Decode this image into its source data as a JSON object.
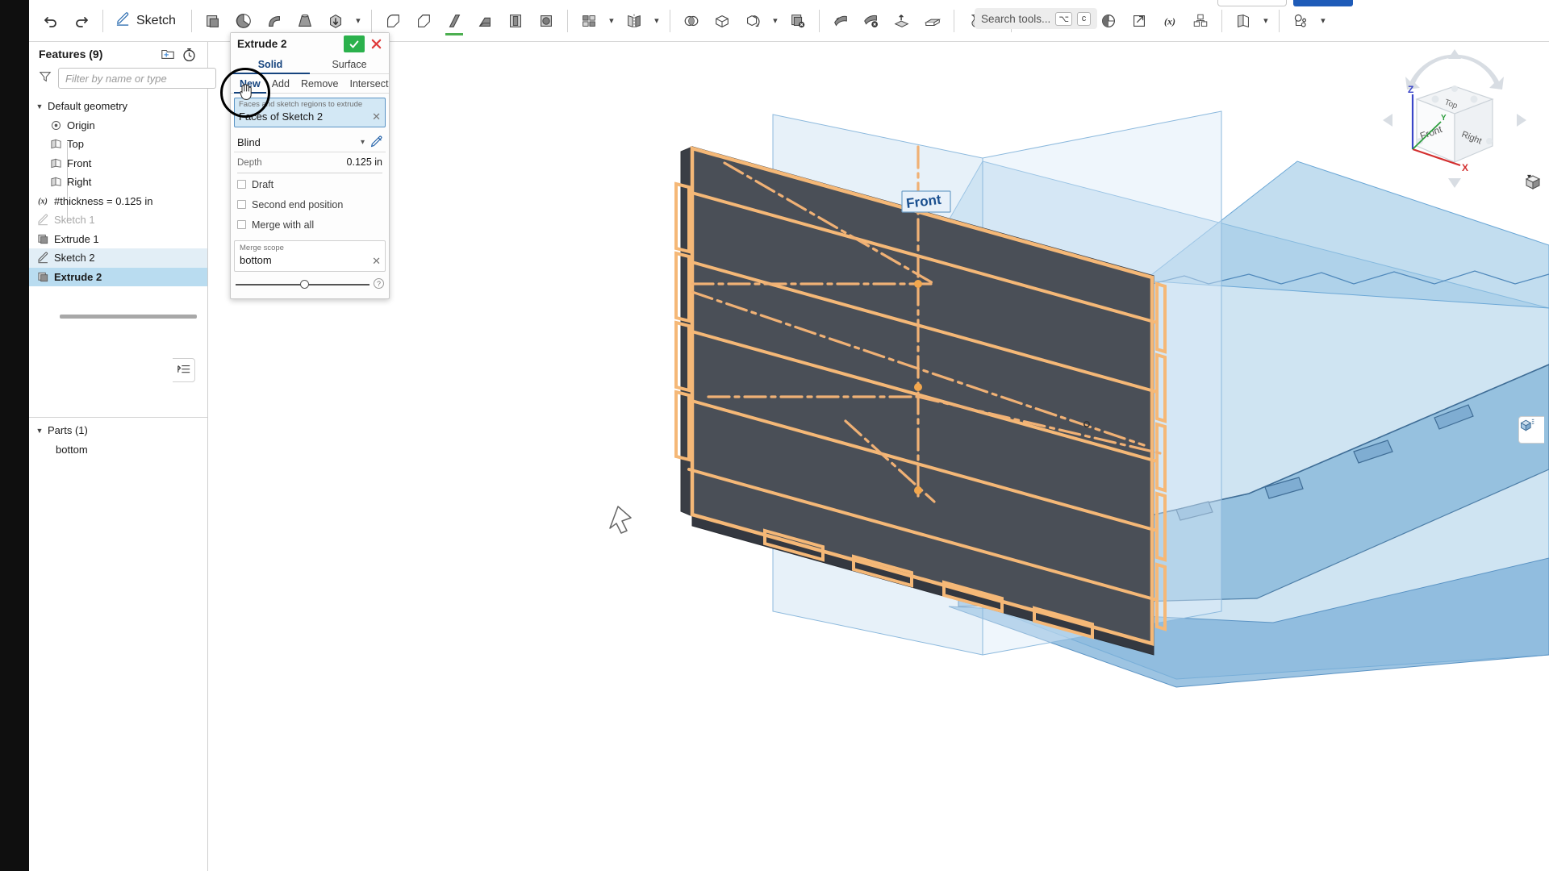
{
  "toolbar": {
    "undo_icon": "undo-arrow-icon",
    "redo_icon": "redo-arrow-icon",
    "sketch_label": "Sketch",
    "sketch_icon": "pencil-sketch-icon",
    "tools": [
      {
        "name": "extrude-icon",
        "glyph": "extrude"
      },
      {
        "name": "revolve-icon",
        "glyph": "revolve"
      },
      {
        "name": "sweep-icon",
        "glyph": "sweep"
      },
      {
        "name": "loft-icon",
        "glyph": "loft"
      },
      {
        "name": "thicken-icon",
        "glyph": "thicken"
      },
      {
        "name": "fillet-icon",
        "glyph": "fillet"
      },
      {
        "name": "chamfer-icon",
        "glyph": "chamfer"
      },
      {
        "name": "rib-icon",
        "glyph": "rib"
      },
      {
        "name": "draft-icon",
        "glyph": "draft"
      },
      {
        "name": "shell-icon",
        "glyph": "shell"
      },
      {
        "name": "hole-icon",
        "glyph": "hole"
      },
      {
        "name": "pattern-icon",
        "glyph": "pattern"
      },
      {
        "name": "mirror-icon",
        "glyph": "mirror"
      },
      {
        "name": "boolean-icon",
        "glyph": "boolean"
      },
      {
        "name": "split-icon",
        "glyph": "split"
      },
      {
        "name": "transform-icon",
        "glyph": "transform"
      },
      {
        "name": "delete-part-icon",
        "glyph": "delete-part"
      },
      {
        "name": "move-face-icon",
        "glyph": "move-face"
      },
      {
        "name": "delete-face-icon",
        "glyph": "delete-face"
      },
      {
        "name": "replace-face-icon",
        "glyph": "replace-face"
      },
      {
        "name": "enclose-icon",
        "glyph": "enclose"
      },
      {
        "name": "sheet-metal-icon",
        "glyph": "sheet-metal"
      },
      {
        "name": "plane-icon",
        "glyph": "plane"
      },
      {
        "name": "curve-icon",
        "glyph": "curve"
      },
      {
        "name": "mate-connector-icon",
        "glyph": "mate-connector"
      },
      {
        "name": "import-derived-icon",
        "glyph": "import-derived"
      },
      {
        "name": "variable-icon",
        "glyph": "variable"
      },
      {
        "name": "composite-part-icon",
        "glyph": "composite"
      },
      {
        "name": "surface-icon",
        "glyph": "surface"
      },
      {
        "name": "assembly-features-icon",
        "glyph": "assembly"
      }
    ],
    "search_placeholder": "Search tools...",
    "search_kbd_1": "⌥",
    "search_kbd_2": "c"
  },
  "feature_tree": {
    "title": "Features (9)",
    "add_folder_icon": "add-folder-icon",
    "history_icon": "history-timer-icon",
    "filter_icon": "filter-funnel-icon",
    "filter_placeholder": "Filter by name or type",
    "items": [
      {
        "label": "Default geometry",
        "icon": "chevron-down-icon",
        "kind": "group",
        "state": "normal"
      },
      {
        "label": "Origin",
        "icon": "origin-icon",
        "kind": "child",
        "state": "normal"
      },
      {
        "label": "Top",
        "icon": "plane-icon",
        "kind": "child",
        "state": "normal"
      },
      {
        "label": "Front",
        "icon": "plane-icon",
        "kind": "child",
        "state": "normal"
      },
      {
        "label": "Right",
        "icon": "plane-icon",
        "kind": "child",
        "state": "normal"
      },
      {
        "label": "#thickness = 0.125 in",
        "icon": "variable-icon",
        "kind": "root",
        "state": "normal"
      },
      {
        "label": "Sketch 1",
        "icon": "sketch-icon",
        "kind": "root",
        "state": "dim"
      },
      {
        "label": "Extrude 1",
        "icon": "extrude-icon",
        "kind": "root",
        "state": "normal"
      },
      {
        "label": "Sketch 2",
        "icon": "sketch-icon",
        "kind": "root",
        "state": "highlight"
      },
      {
        "label": "Extrude 2",
        "icon": "extrude-icon",
        "kind": "root",
        "state": "selected"
      }
    ],
    "parts": {
      "title": "Parts (1)",
      "chevron": "chevron-down-icon",
      "items": [
        {
          "label": "bottom"
        }
      ]
    },
    "panel_toggle_icon": "tree-collapse-icon"
  },
  "dialog": {
    "title": "Extrude 2",
    "accept_icon": "checkmark-icon",
    "cancel_icon": "close-x-icon",
    "type_tabs": [
      {
        "label": "Solid",
        "active": true
      },
      {
        "label": "Surface",
        "active": false
      }
    ],
    "op_tabs": [
      {
        "label": "New",
        "active": true
      },
      {
        "label": "Add",
        "active": false
      },
      {
        "label": "Remove",
        "active": false
      },
      {
        "label": "Intersect",
        "active": false
      }
    ],
    "selection": {
      "hint": "Faces and sketch regions to extrude",
      "value": "Faces of Sketch 2",
      "clear_icon": "clear-x-icon"
    },
    "end_type": {
      "value": "Blind",
      "caret_icon": "chevron-down-icon",
      "flip_icon": "flip-direction-icon"
    },
    "depth": {
      "label": "Depth",
      "value": "0.125 in"
    },
    "checkboxes": [
      {
        "label": "Draft",
        "checked": false
      },
      {
        "label": "Second end position",
        "checked": false
      },
      {
        "label": "Merge with all",
        "checked": false
      }
    ],
    "merge_scope": {
      "hint": "Merge scope",
      "value": "bottom",
      "clear_icon": "clear-x-icon"
    },
    "opacity_slider": {
      "value": 48
    },
    "help_icon": "help-question-icon"
  },
  "viewport": {
    "plane_label": "Front",
    "cursor_icon": "rotate-cursor-icon",
    "colors": {
      "face_dark": "#4a4f57",
      "sketch_highlight": "#f5b877",
      "plane_fill": "#8fc0e4",
      "plane_edge": "#5b9bd0",
      "accent_blue": "#16447e"
    }
  },
  "navcube": {
    "faces": {
      "top": "Top",
      "front": "Front",
      "right": "Right"
    },
    "axes": {
      "x": "X",
      "y": "Y",
      "z": "Z"
    },
    "x_color": "#d32f2f",
    "y_color": "#2e9e3e",
    "z_color": "#3a46c8",
    "view_menu_icon": "view-cube-menu-icon",
    "view_caret_icon": "chevron-down-icon"
  },
  "bottom_right": {
    "panel_icon": "render-panel-icon"
  }
}
